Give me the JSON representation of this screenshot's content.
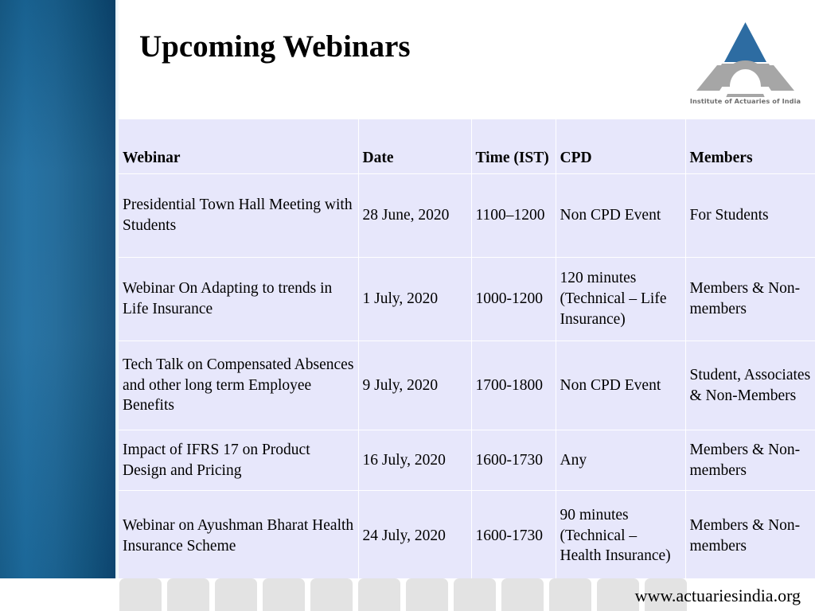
{
  "slide": {
    "title": "Upcoming Webinars",
    "accent_blue": "#1a6596",
    "table_bg": "#e7e7fb",
    "logo_triangle_color": "#2d6ca2",
    "logo_gray": "#a6a6a6"
  },
  "logo": {
    "caption": "Institute of Actuaries of India",
    "icon": "iai-triangle-logo"
  },
  "table": {
    "headers": [
      "Webinar",
      "Date",
      "Time (IST)",
      "CPD",
      "Members"
    ],
    "rows": [
      {
        "webinar": "Presidential Town Hall Meeting with Students",
        "date": "28 June, 2020",
        "time": "1100–1200",
        "cpd": "Non CPD Event",
        "members": "For Students"
      },
      {
        "webinar": "Webinar On Adapting to trends in Life Insurance",
        "date": "1 July, 2020",
        "time": "1000-1200",
        "cpd": "120 minutes (Technical – Life Insurance)",
        "members": "Members & Non-members"
      },
      {
        "webinar": "Tech Talk on Compensated Absences and other long term Employee Benefits",
        "date": "9 July, 2020",
        "time": "1700-1800",
        "cpd": "Non CPD Event",
        "members": "Student, Associates & Non-Members"
      },
      {
        "webinar": "Impact of IFRS 17 on Product Design and Pricing",
        "date": "16 July, 2020",
        "time": "1600-1730",
        "cpd": "Any",
        "members": "Members & Non-members"
      },
      {
        "webinar": "Webinar on Ayushman Bharat Health Insurance Scheme",
        "date": "24 July, 2020",
        "time": "1600-1730",
        "cpd": "90 minutes (Technical – Health Insurance)",
        "members": "Members & Non-members"
      }
    ]
  },
  "footer": {
    "url": "www.actuariesindia.org",
    "block_count": 12
  }
}
